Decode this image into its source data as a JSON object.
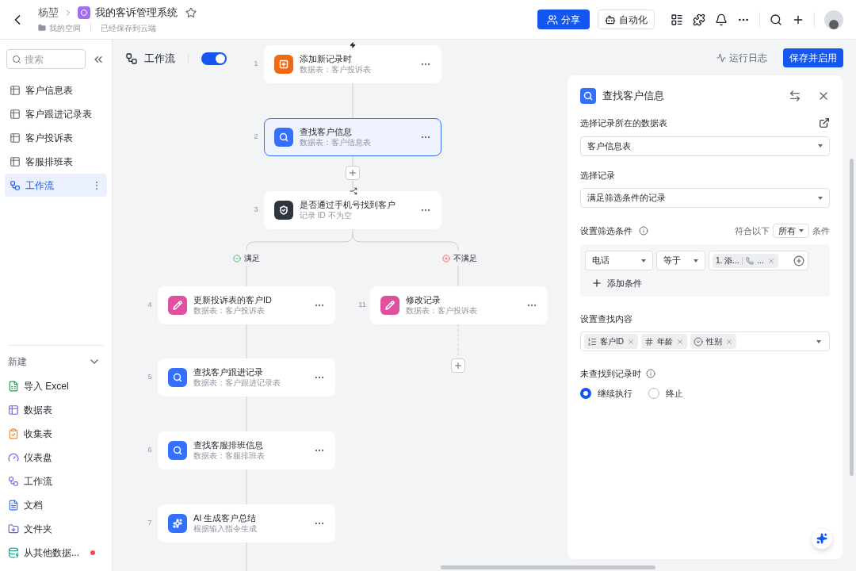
{
  "header": {
    "parent": "杨堃",
    "app_title": "我的客诉管理系统",
    "location": "我的空间",
    "save_status": "已经保存到云端",
    "share": "分享",
    "automation": "自动化"
  },
  "sidebar": {
    "search_placeholder": "搜索",
    "items": [
      {
        "label": "客户信息表",
        "kind": "table",
        "selected": false
      },
      {
        "label": "客户跟进记录表",
        "kind": "table",
        "selected": false
      },
      {
        "label": "客户投诉表",
        "kind": "table",
        "selected": false
      },
      {
        "label": "客服排班表",
        "kind": "table",
        "selected": false
      },
      {
        "label": "工作流",
        "kind": "workflow",
        "selected": true
      }
    ],
    "new_label": "新建",
    "create_items": [
      {
        "label": "导入 Excel",
        "kind": "excel",
        "dot": false
      },
      {
        "label": "数据表",
        "kind": "table",
        "dot": false
      },
      {
        "label": "收集表",
        "kind": "form",
        "dot": false
      },
      {
        "label": "仪表盘",
        "kind": "dashboard",
        "dot": false
      },
      {
        "label": "工作流",
        "kind": "workflow",
        "dot": false
      },
      {
        "label": "文档",
        "kind": "doc",
        "dot": false
      },
      {
        "label": "文件夹",
        "kind": "folder",
        "dot": false
      },
      {
        "label": "从其他数据...",
        "kind": "import",
        "dot": true
      }
    ]
  },
  "toolbar": {
    "title": "工作流",
    "enabled": true,
    "run_log": "运行日志",
    "save": "保存并启用"
  },
  "nodes": [
    {
      "number": "1",
      "title": "添加新记录时",
      "subtitle": "数据表：客户投诉表",
      "kind": "trigger",
      "selected": false
    },
    {
      "number": "2",
      "title": "查找客户信息",
      "subtitle": "数据表：客户信息表",
      "kind": "find",
      "selected": true
    },
    {
      "number": "3",
      "title": "是否通过手机号找到客户",
      "subtitle": "记录 ID 不为空",
      "kind": "condition",
      "selected": false
    },
    {
      "number": "4",
      "title": "更新投诉表的客户ID",
      "subtitle": "数据表：客户投诉表",
      "kind": "update",
      "selected": false
    },
    {
      "number": "11",
      "title": "修改记录",
      "subtitle": "数据表：客户投诉表",
      "kind": "update",
      "selected": false
    },
    {
      "number": "5",
      "title": "查找客户跟进记录",
      "subtitle": "数据表：客户跟进记录表",
      "kind": "find",
      "selected": false
    },
    {
      "number": "6",
      "title": "查找客服排班信息",
      "subtitle": "数据表：客服排班表",
      "kind": "find",
      "selected": false
    },
    {
      "number": "7",
      "title": "AI 生成客户总结",
      "subtitle": "根据输入指令生成",
      "kind": "ai",
      "selected": false
    }
  ],
  "branches": [
    {
      "label": "满足",
      "kind": "pass"
    },
    {
      "label": "不满足",
      "kind": "fail"
    }
  ],
  "panel": {
    "title": "查找客户信息",
    "table_label": "选择记录所在的数据表",
    "table_value": "客户信息表",
    "record_label": "选择记录",
    "record_value": "满足筛选条件的记录",
    "filter_label": "设置筛选条件",
    "match_prefix": "符合以下",
    "match_value": "所有",
    "match_suffix": "条件",
    "conditions": [
      {
        "field": "电话",
        "operator": "等于",
        "value_source": "1. 添...",
        "value_field": "..."
      }
    ],
    "add_condition": "添加条件",
    "fields_label": "设置查找内容",
    "fields": [
      {
        "label": "客户ID",
        "kind": "autonumber"
      },
      {
        "label": "年龄",
        "kind": "number"
      },
      {
        "label": "性别",
        "kind": "option"
      }
    ],
    "not_found_label": "未查找到记录时",
    "options": [
      {
        "label": "继续执行",
        "selected": true
      },
      {
        "label": "终止",
        "selected": false
      }
    ]
  }
}
